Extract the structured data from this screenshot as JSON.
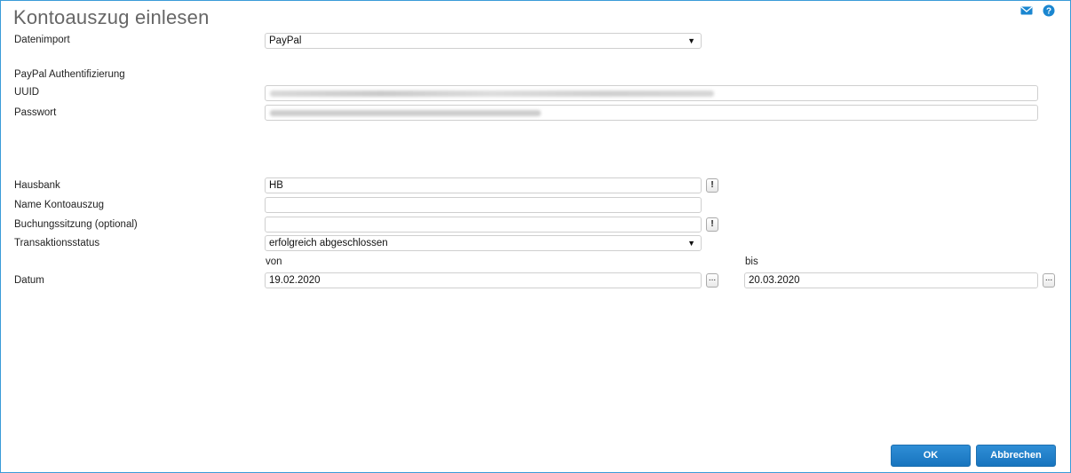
{
  "window": {
    "title": "Kontoauszug einlesen"
  },
  "icons": {
    "mail": "mail-icon",
    "help": "help-icon",
    "accent_color": "#1a86d0"
  },
  "form": {
    "datenimport": {
      "label": "Datenimport",
      "value": "PayPal"
    },
    "auth_section": {
      "label": "PayPal Authentifizierung"
    },
    "uuid": {
      "label": "UUID",
      "value": ""
    },
    "passwort": {
      "label": "Passwort",
      "value": ""
    },
    "hausbank": {
      "label": "Hausbank",
      "value": "HB",
      "button": "!"
    },
    "name_kontoauszug": {
      "label": "Name Kontoauszug",
      "value": ""
    },
    "buchungssitzung": {
      "label": "Buchungssitzung (optional)",
      "value": "",
      "button": "!"
    },
    "transaktionsstatus": {
      "label": "Transaktionsstatus",
      "value": "erfolgreich abgeschlossen"
    },
    "datum": {
      "label": "Datum",
      "von_label": "von",
      "bis_label": "bis",
      "von": "19.02.2020",
      "bis": "20.03.2020",
      "picker_label": "..."
    }
  },
  "buttons": {
    "ok": "OK",
    "cancel": "Abbrechen"
  }
}
